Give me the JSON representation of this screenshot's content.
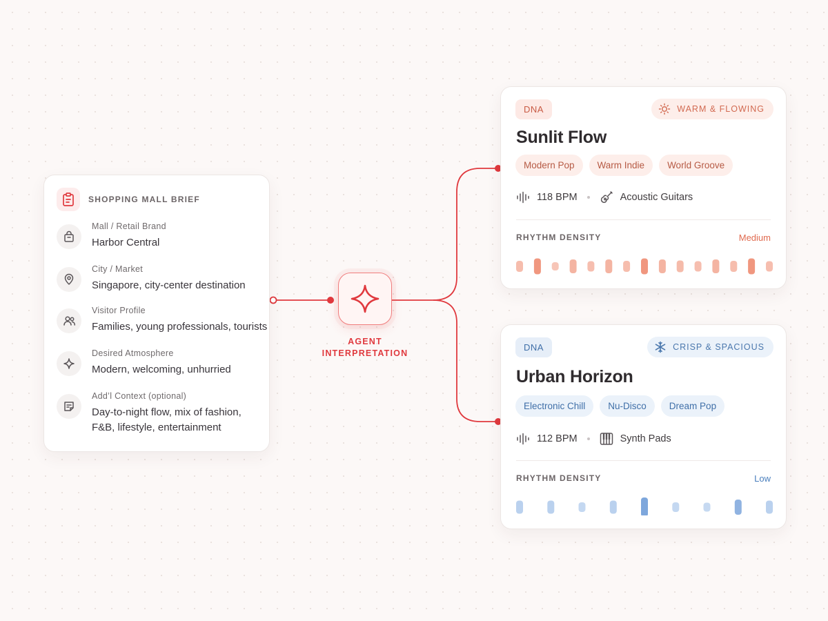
{
  "brief": {
    "title": "SHOPPING MALL BRIEF",
    "fields": [
      {
        "label": "Mall / Retail Brand",
        "value": "Harbor Central",
        "icon": "shopping-bag-icon"
      },
      {
        "label": "City / Market",
        "value": "Singapore, city-center destination",
        "icon": "map-pin-icon"
      },
      {
        "label": "Visitor Profile",
        "value": "Families, young professionals, tourists",
        "icon": "users-icon"
      },
      {
        "label": "Desired Atmosphere",
        "value": "Modern, welcoming, unhurried",
        "icon": "sparkle-icon"
      },
      {
        "label": "Add’l Context (optional)",
        "value": "Day-to-night flow, mix of fashion, F&B, lifestyle, entertainment",
        "icon": "note-icon"
      }
    ]
  },
  "agent": {
    "label": "AGENT INTERPRETATION",
    "icon": "sparkle-icon"
  },
  "outputs": [
    {
      "badge": "DNA",
      "mood": "WARM & FLOWING",
      "mood_icon": "sun-icon",
      "name": "Sunlit Flow",
      "tags": [
        "Modern Pop",
        "Warm Indie",
        "World Groove"
      ],
      "bpm": "118 BPM",
      "instrument": "Acoustic Guitars",
      "instrument_icon": "guitar-icon",
      "rhythm_label": "RHYTHM DENSITY",
      "rhythm_value": "Medium",
      "rhythm_levels": [
        0.4,
        0.75,
        0.2,
        0.6,
        0.35,
        0.6,
        0.4,
        0.75,
        0.6,
        0.45,
        0.35,
        0.6,
        0.4,
        0.75,
        0.35
      ],
      "accent": "#f2a48e",
      "accent_strong": "#ee8a6f"
    },
    {
      "badge": "DNA",
      "mood": "CRISP & SPACIOUS",
      "mood_icon": "snowflake-icon",
      "name": "Urban Horizon",
      "tags": [
        "Electronic Chill",
        "Nu-Disco",
        "Dream Pop"
      ],
      "bpm": "112 BPM",
      "instrument": "Synth Pads",
      "instrument_icon": "keyboard-icon",
      "rhythm_label": "RHYTHM DENSITY",
      "rhythm_value": "Low",
      "rhythm_levels": [
        0.55,
        0,
        0.55,
        0,
        0.3,
        0,
        0.55,
        0,
        1.0,
        0,
        0.3,
        0,
        0.25,
        0,
        0.7,
        0,
        0.55
      ],
      "accent": "#a9c6ea",
      "accent_strong": "#7ea7dc"
    }
  ],
  "colors": {
    "connector": "#e0393e",
    "accent": "#e0393e"
  }
}
